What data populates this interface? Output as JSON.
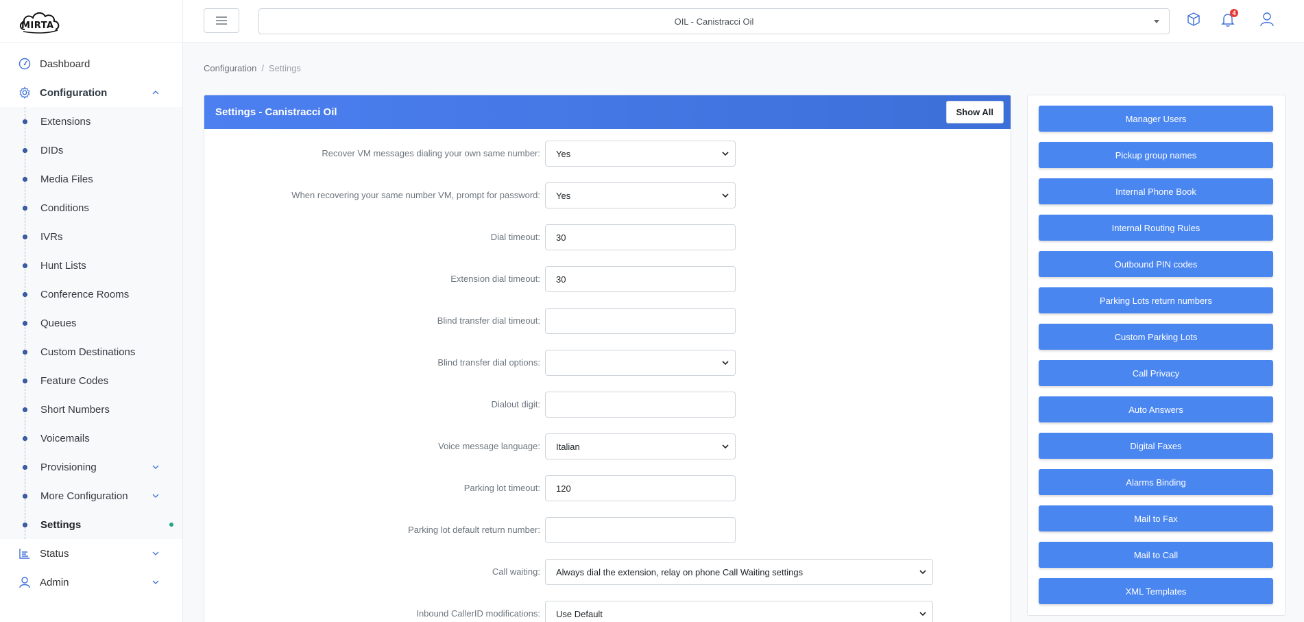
{
  "app": {
    "logo_text": "MIRTA"
  },
  "topbar": {
    "tenant": "OIL - Canistracci Oil",
    "notification_count": "4"
  },
  "sidebar": {
    "dashboard": "Dashboard",
    "configuration": "Configuration",
    "config_items": [
      "Extensions",
      "DIDs",
      "Media Files",
      "Conditions",
      "IVRs",
      "Hunt Lists",
      "Conference Rooms",
      "Queues",
      "Custom Destinations",
      "Feature Codes",
      "Short Numbers",
      "Voicemails",
      "Provisioning",
      "More Configuration",
      "Settings"
    ],
    "status": "Status",
    "admin": "Admin"
  },
  "breadcrumb": {
    "root": "Configuration",
    "sep": "/",
    "current": "Settings"
  },
  "card": {
    "title": "Settings - Canistracci Oil",
    "show_all": "Show All"
  },
  "form": {
    "fields": [
      {
        "label": "Recover VM messages dialing your own same number:",
        "value": "Yes",
        "type": "select"
      },
      {
        "label": "When recovering your same number VM, prompt for password:",
        "value": "Yes",
        "type": "select"
      },
      {
        "label": "Dial timeout:",
        "value": "30",
        "type": "input"
      },
      {
        "label": "Extension dial timeout:",
        "value": "30",
        "type": "input"
      },
      {
        "label": "Blind transfer dial timeout:",
        "value": "",
        "type": "input"
      },
      {
        "label": "Blind transfer dial options:",
        "value": "",
        "type": "select"
      },
      {
        "label": "Dialout digit:",
        "value": "",
        "type": "input"
      },
      {
        "label": "Voice message language:",
        "value": "Italian",
        "type": "select"
      },
      {
        "label": "Parking lot timeout:",
        "value": "120",
        "type": "input"
      },
      {
        "label": "Parking lot default return number:",
        "value": "",
        "type": "input"
      },
      {
        "label": "Call waiting:",
        "value": "Always dial the extension, relay on phone Call Waiting settings",
        "type": "select-long"
      },
      {
        "label": "Inbound CallerID modifications:",
        "value": "Use Default",
        "type": "select-long"
      }
    ]
  },
  "right_panel": {
    "buttons": [
      "Manager Users",
      "Pickup group names",
      "Internal Phone Book",
      "Internal Routing Rules",
      "Outbound PIN codes",
      "Parking Lots return numbers",
      "Custom Parking Lots",
      "Call Privacy",
      "Auto Answers",
      "Digital Faxes",
      "Alarms Binding",
      "Mail to Fax",
      "Mail to Call",
      "XML Templates"
    ]
  },
  "colors": {
    "accent": "#4a86f0",
    "header": "#4c7ff0",
    "badge": "#e53935",
    "active_dot": "#25a580"
  }
}
